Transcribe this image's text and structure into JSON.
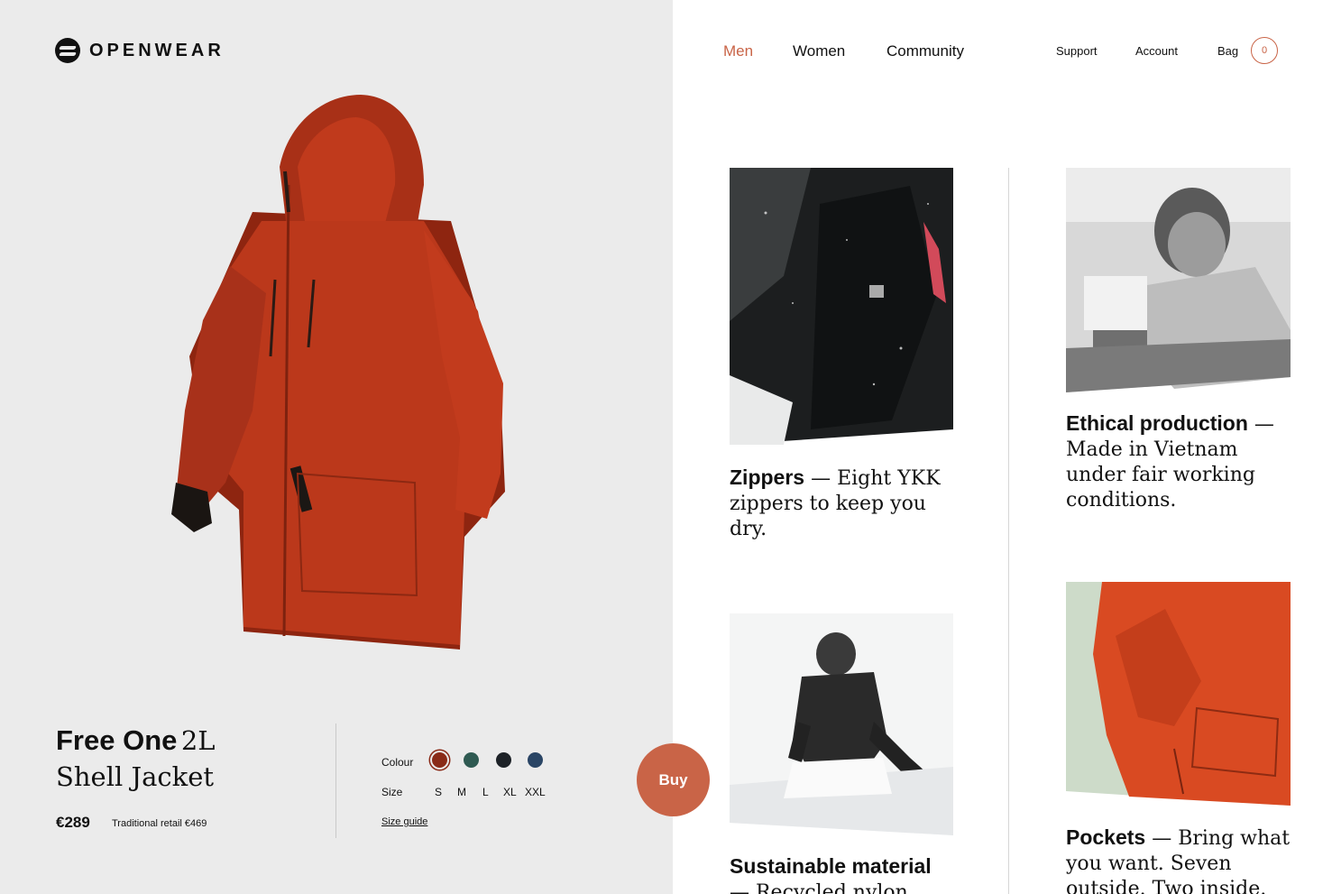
{
  "brand": {
    "name": "OPENWEAR"
  },
  "nav": {
    "main": [
      {
        "label": "Men",
        "active": true
      },
      {
        "label": "Women",
        "active": false
      },
      {
        "label": "Community",
        "active": false
      }
    ],
    "secondary": {
      "support": "Support",
      "account": "Account",
      "bag": "Bag",
      "bag_count": "0"
    }
  },
  "product": {
    "name_bold": "Free One",
    "name_serif_1": "2L",
    "name_serif_2": "Shell Jacket",
    "price": "€289",
    "retail": "Traditional retail €469",
    "colour_label": "Colour",
    "size_label": "Size",
    "colours": [
      "#8a2b18",
      "#2f5a52",
      "#1d2227",
      "#2a4565"
    ],
    "sizes": [
      "S",
      "M",
      "L",
      "XL",
      "XXL"
    ],
    "size_guide": "Size guide",
    "buy": "Buy"
  },
  "features": [
    {
      "title": "Zippers",
      "line1": " — Eight YKK",
      "line2": "zippers to keep you",
      "line3": "dry."
    },
    {
      "title": "Ethical production",
      "line1": " —",
      "line2": "Made in Vietnam",
      "line3": "under fair working",
      "line4": "conditions."
    },
    {
      "title": "Sustainable material",
      "line1": "— Recycled nylon"
    },
    {
      "title": "Pockets",
      "line1": " — Bring what",
      "line2": "you want. Seven",
      "line3": "outside. Two inside."
    }
  ],
  "colors": {
    "accent": "#c96447",
    "panel": "#ebebeb",
    "jacket": "#b8361a"
  }
}
